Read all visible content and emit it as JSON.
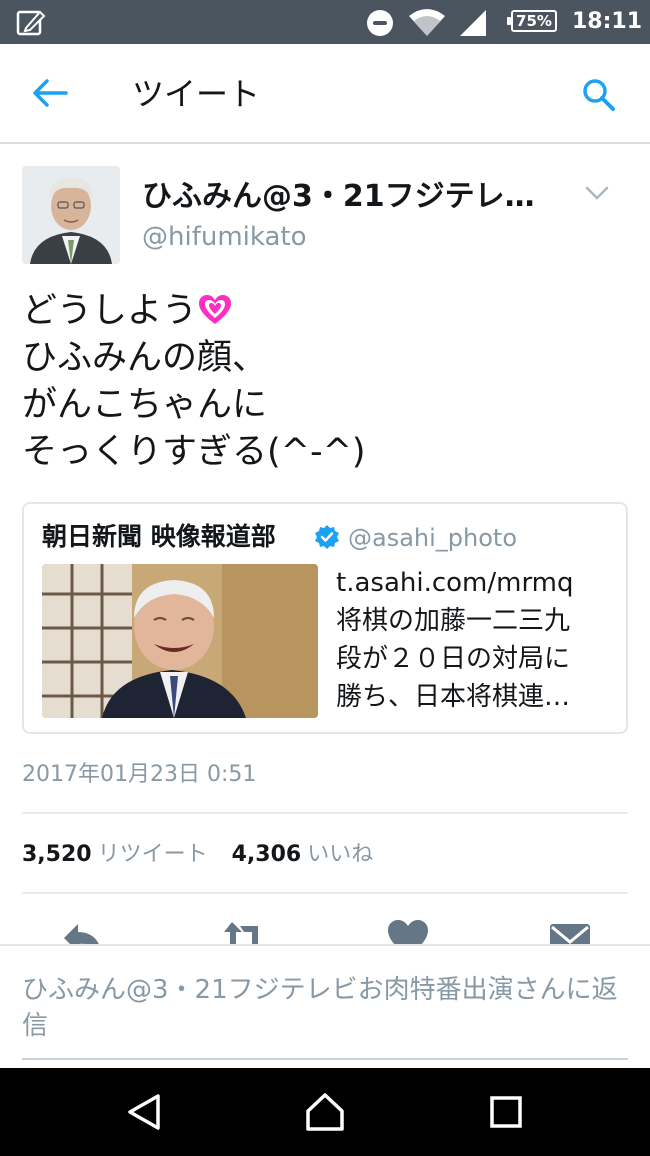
{
  "status_bar": {
    "battery": "75%",
    "time": "18:11",
    "icons": [
      "edit-note-icon",
      "do-not-disturb-icon",
      "wifi-icon",
      "cell-signal-icon",
      "battery-icon"
    ]
  },
  "header": {
    "title": "ツイート",
    "back_icon": "back-arrow-icon",
    "search_icon": "search-icon"
  },
  "tweet": {
    "author_name": "ひふみん@3・21フジテレ…",
    "author_handle": "@hifumikato",
    "text_lines": [
      "どうしよう",
      "ひふみんの顔、",
      "がんこちゃんに",
      "そっくりすぎる(^-^)"
    ],
    "emoji": "sparkling-heart-icon",
    "timestamp": "2017年01月23日 0:51",
    "retweet_count": "3,520",
    "retweet_label": "リツイート",
    "like_count": "4,306",
    "like_label": "いいね"
  },
  "quoted_tweet": {
    "name": "朝日新聞 映像報道部",
    "verified": true,
    "handle": "@asahi_photo",
    "text_lines": [
      "t.asahi.com/mrmq",
      "将棋の加藤一二三九",
      "段が２０日の対局に",
      "勝ち、日本将棋連…"
    ]
  },
  "actions": [
    "reply-icon",
    "retweet-icon",
    "like-icon",
    "message-icon"
  ],
  "reply_bar": {
    "placeholder": "ひふみん@3・21フジテレビお肉特番出演さんに返信"
  },
  "colors": {
    "status_bar": "#4b5560",
    "accent": "#1da1f2",
    "secondary_text": "#8899a6",
    "heart": "#ff2ec2",
    "action_icon": "#657786"
  }
}
